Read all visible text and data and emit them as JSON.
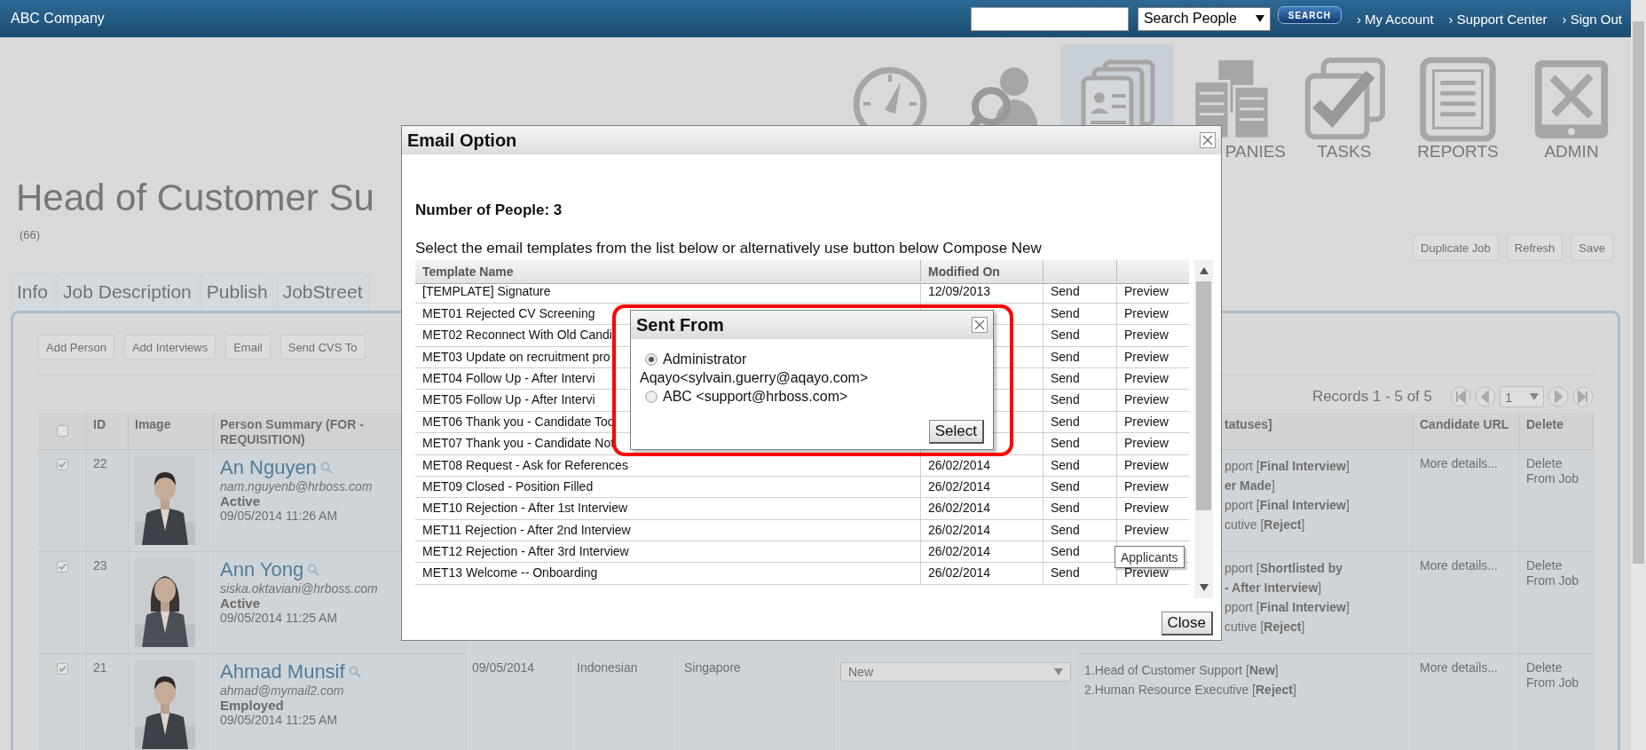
{
  "top_bar": {
    "brand": "ABC Company",
    "search_scope": "Search People",
    "search_button": "SEARCH",
    "links": [
      "› My Account",
      "› Support Center",
      "› Sign Out"
    ]
  },
  "nav": [
    {
      "kind": "dashboard",
      "selected": false
    },
    {
      "kind": "candidates",
      "selected": false
    },
    {
      "kind": "jobs",
      "selected": true
    },
    {
      "kind": "companies",
      "label": "PANIES",
      "selected": false
    },
    {
      "kind": "tasks",
      "label": "TASKS",
      "selected": false
    },
    {
      "kind": "reports",
      "label": "REPORTS",
      "selected": false
    },
    {
      "kind": "admin",
      "label": "ADMIN",
      "selected": false
    }
  ],
  "job": {
    "title": "Head of Customer Su",
    "count": "(66)",
    "actions": [
      "Duplicate Job",
      "Refresh",
      "Save"
    ]
  },
  "tabs": [
    {
      "label": "Info",
      "selected": false
    },
    {
      "label": "Job Description",
      "selected": false
    },
    {
      "label": "Publish",
      "selected": false
    },
    {
      "label": "JobStreet",
      "selected": false
    }
  ],
  "toolbar": [
    "Add Person",
    "Add Interviews",
    "Email",
    "Send CVS To"
  ],
  "pager": {
    "records": "Records 1 - 5 of 5",
    "page": "1"
  },
  "people_table": {
    "select_all_checked": false,
    "columns": {
      "id": "ID",
      "image": "Image",
      "summary": "Person Summary (FOR - REQUISITION)",
      "statuses": "tatuses]",
      "candidate_url": "Candidate URL",
      "delete": "Delete"
    },
    "rows": [
      {
        "checked": true,
        "id": "22",
        "name": "An Nguyen",
        "email": "nam.nguyenb@hrboss.com",
        "status": "Active",
        "updated": "09/05/2014 11:26 AM",
        "statuses": [
          "pport [**Final Interview**]",
          "**er Made**]",
          "pport [**Final Interview**]",
          "cutive [**Reject**]"
        ],
        "candidate_url": "More details...",
        "delete": "Delete From Job"
      },
      {
        "checked": true,
        "id": "23",
        "name": "Ann Yong",
        "email": "siska.oktaviani@hrboss.com",
        "status": "Active",
        "updated": "09/05/2014 11:25 AM",
        "statuses": [
          "pport [**Shortlisted by**",
          "**- After Interview**]",
          "pport [**Final Interview**]",
          "cutive [**Reject**]"
        ],
        "candidate_url": "More details...",
        "delete": "Delete From Job"
      },
      {
        "checked": true,
        "id": "21",
        "name": "Ahmad Munsif",
        "email": "ahmad@mymail2.com",
        "status": "Employed",
        "updated": "09/05/2014 11:25 AM",
        "date": "09/05/2014",
        "nationality": "Indonesian",
        "location": "Singapore",
        "stage": "New",
        "statuses": [
          "1.Head of Customer Support [**New**]",
          "2.Human Resource Executive [**Reject**]"
        ],
        "candidate_url": "More details...",
        "delete": "Delete From Job"
      }
    ]
  },
  "email_dialog": {
    "title": "Email Option",
    "people_count": "Number of People: 3",
    "instruction": "Select the email templates from the list below or alternatively use button below Compose New",
    "columns": [
      "Template Name",
      "Modified On"
    ],
    "templates": [
      {
        "name": "[TEMPLATE] Signature",
        "modified": "12/09/2013",
        "send": "Send",
        "preview": "Preview"
      },
      {
        "name": "MET01 Rejected CV Screening",
        "send": "Send",
        "preview": "Preview"
      },
      {
        "name": "MET02 Reconnect With Old Candi",
        "send": "Send",
        "preview": "Preview"
      },
      {
        "name": "MET03 Update on recruitment pro",
        "send": "Send",
        "preview": "Preview"
      },
      {
        "name": "MET04 Follow Up - After Intervi",
        "send": "Send",
        "preview": "Preview"
      },
      {
        "name": "MET05 Follow Up - After Intervi",
        "send": "Send",
        "preview": "Preview"
      },
      {
        "name": "MET06 Thank you - Candidate Too",
        "send": "Send",
        "preview": "Preview"
      },
      {
        "name": "MET07 Thank you - Candidate Not",
        "send": "Send",
        "preview": "Preview"
      },
      {
        "name": "MET08 Request - Ask for References",
        "modified": "26/02/2014",
        "send": "Send",
        "preview": "Preview"
      },
      {
        "name": "MET09 Closed - Position Filled",
        "modified": "26/02/2014",
        "send": "Send",
        "preview": "Preview"
      },
      {
        "name": "MET10 Rejection - After 1st Interview",
        "modified": "26/02/2014",
        "send": "Send",
        "preview": "Preview"
      },
      {
        "name": "MET11 Rejection - After 2nd Interview",
        "modified": "26/02/2014",
        "send": "Send",
        "preview": "Preview"
      },
      {
        "name": "MET12 Rejection - After 3rd Interview",
        "modified": "26/02/2014",
        "send": "Send"
      },
      {
        "name": "MET13 Welcome -- Onboarding",
        "modified": "26/02/2014",
        "send": "Send",
        "preview": "Preview"
      }
    ],
    "close_button": "Close"
  },
  "sent_from": {
    "title": "Sent From",
    "options": [
      {
        "label": "Administrator",
        "address": "Aqayo<sylvain.guerry@aqayo.com>",
        "selected": true
      },
      {
        "label": "ABC <support@hrboss.com>",
        "selected": false
      }
    ],
    "button": "Select"
  },
  "tooltip": "Applicants"
}
